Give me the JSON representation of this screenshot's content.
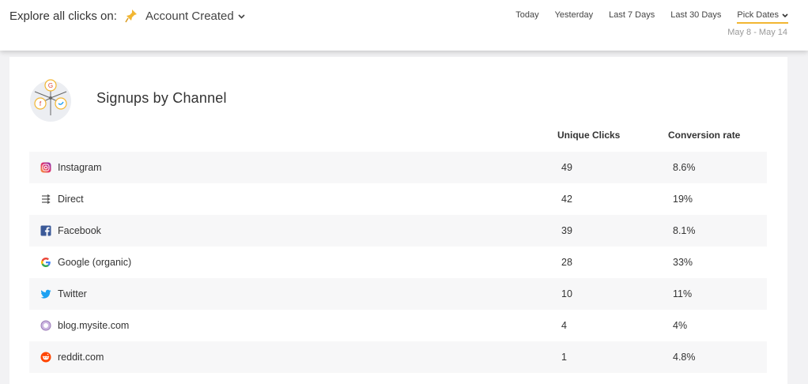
{
  "header": {
    "explore_label": "Explore all clicks on:",
    "event_name": "Account Created",
    "date_filters": [
      "Today",
      "Yesterday",
      "Last 7 Days",
      "Last 30 Days"
    ],
    "pick_dates_label": "Pick Dates",
    "date_range": "May 8 - May 14",
    "accent_color": "#f2b632"
  },
  "card": {
    "title": "Signups by Channel",
    "columns": {
      "unique_clicks": "Unique Clicks",
      "conversion_rate": "Conversion rate"
    },
    "rows": [
      {
        "channel": "Instagram",
        "icon": "instagram-icon",
        "unique_clicks": "49",
        "conversion_rate": "8.6%"
      },
      {
        "channel": "Direct",
        "icon": "direct-icon",
        "unique_clicks": "42",
        "conversion_rate": "19%"
      },
      {
        "channel": "Facebook",
        "icon": "facebook-icon",
        "unique_clicks": "39",
        "conversion_rate": "8.1%"
      },
      {
        "channel": "Google (organic)",
        "icon": "google-icon",
        "unique_clicks": "28",
        "conversion_rate": "33%"
      },
      {
        "channel": "Twitter",
        "icon": "twitter-icon",
        "unique_clicks": "10",
        "conversion_rate": "11%"
      },
      {
        "channel": "blog.mysite.com",
        "icon": "blog-icon",
        "unique_clicks": "4",
        "conversion_rate": "4%"
      },
      {
        "channel": "reddit.com",
        "icon": "reddit-icon",
        "unique_clicks": "1",
        "conversion_rate": "4.8%"
      }
    ]
  }
}
